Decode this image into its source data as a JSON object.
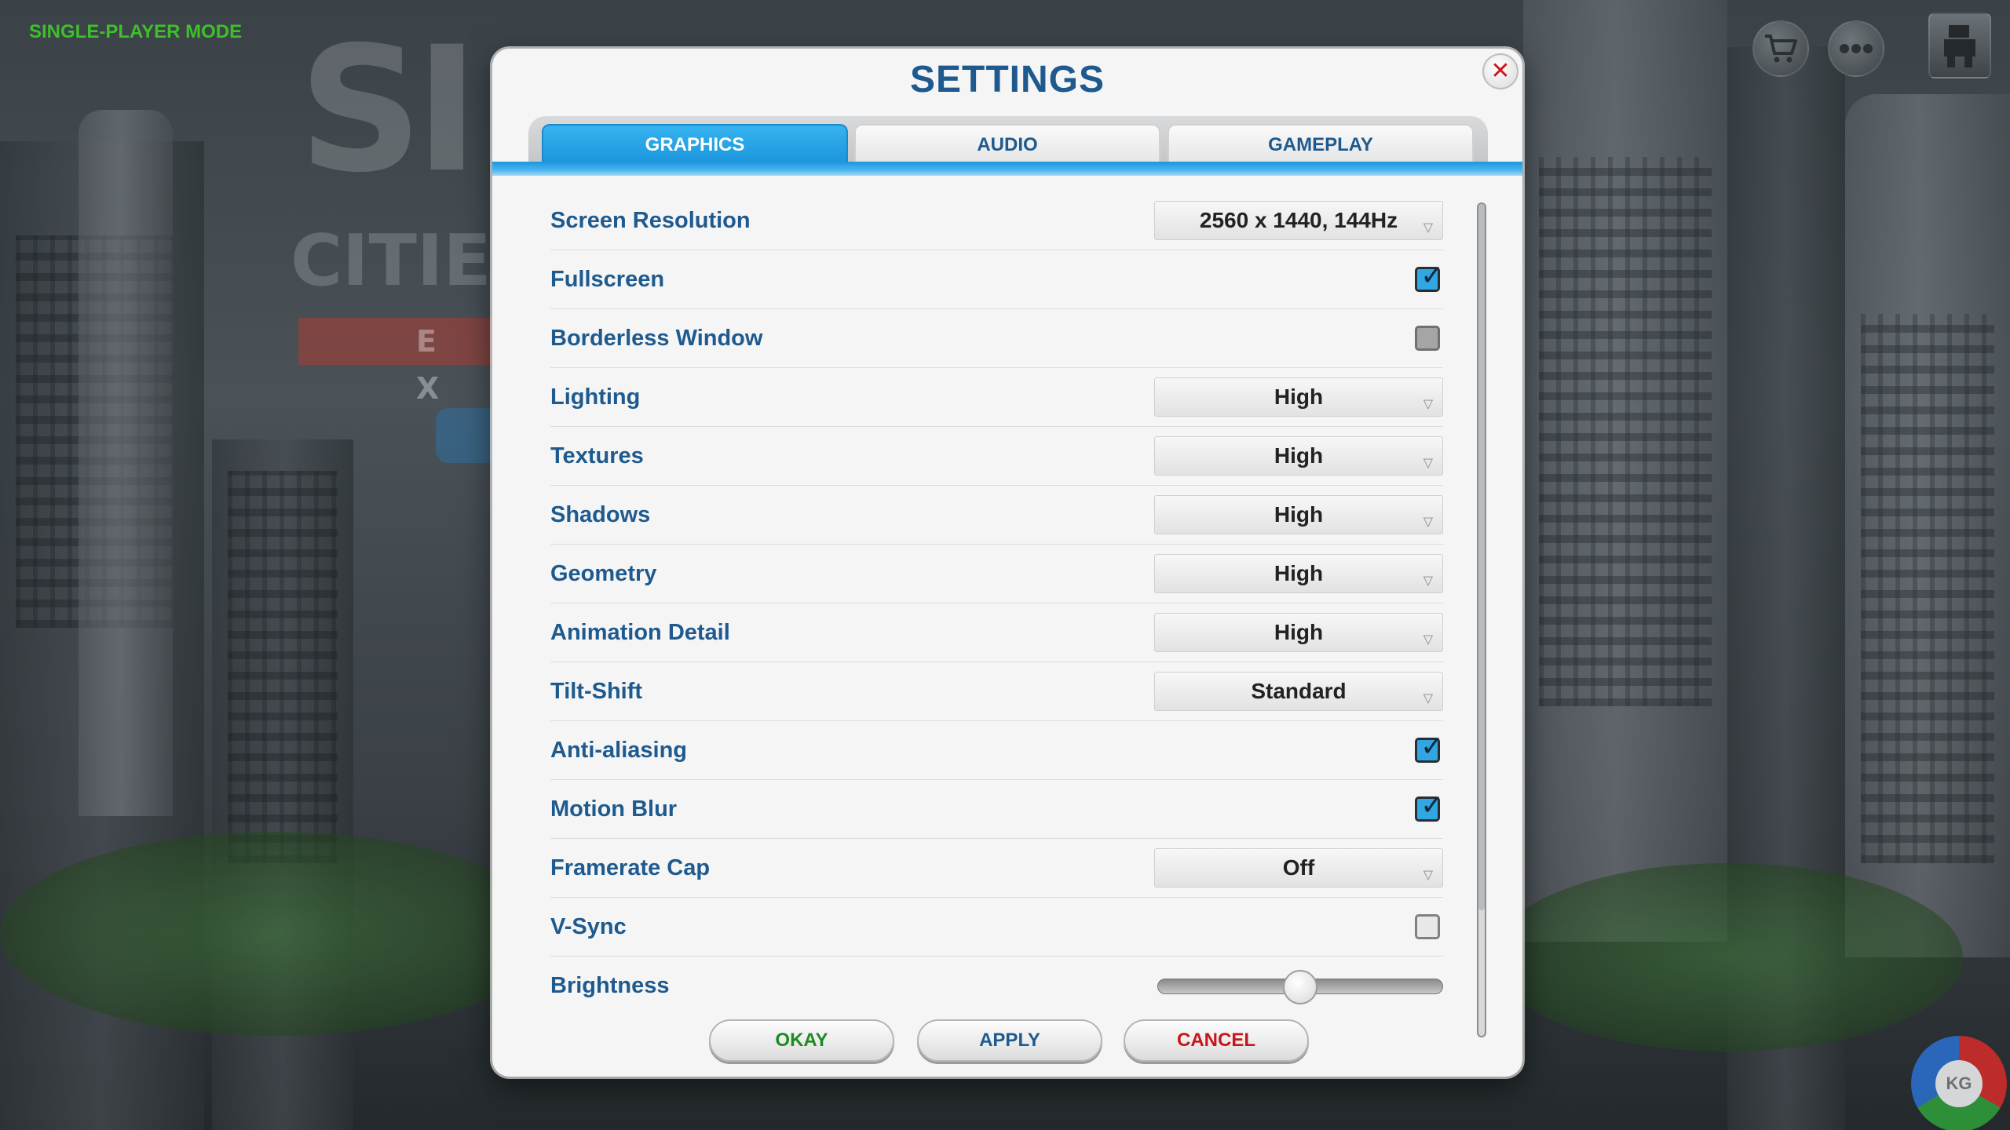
{
  "game_mode": "SINGLE-PLAYER MODE",
  "background_logo": {
    "line1": "SI",
    "line2": "CITIE",
    "strip": "E X"
  },
  "top_bar": {
    "cart_icon": "shopping-cart-icon",
    "more_icon": "ellipsis-icon",
    "avatar_icon": "player-avatar-icon"
  },
  "corner_watermark": "KG",
  "dialog": {
    "title": "SETTINGS",
    "close_glyph": "✕",
    "tabs": [
      {
        "label": "GRAPHICS",
        "active": true
      },
      {
        "label": "AUDIO",
        "active": false
      },
      {
        "label": "GAMEPLAY",
        "active": false
      }
    ],
    "settings": {
      "screen_resolution": {
        "label": "Screen Resolution",
        "value": "2560 x 1440, 144Hz"
      },
      "fullscreen": {
        "label": "Fullscreen",
        "checked": true
      },
      "borderless_window": {
        "label": "Borderless Window",
        "checked": false
      },
      "lighting": {
        "label": "Lighting",
        "value": "High"
      },
      "textures": {
        "label": "Textures",
        "value": "High"
      },
      "shadows": {
        "label": "Shadows",
        "value": "High"
      },
      "geometry": {
        "label": "Geometry",
        "value": "High"
      },
      "animation_detail": {
        "label": "Animation Detail",
        "value": "High"
      },
      "tilt_shift": {
        "label": "Tilt-Shift",
        "value": "Standard"
      },
      "anti_aliasing": {
        "label": "Anti-aliasing",
        "checked": true
      },
      "motion_blur": {
        "label": "Motion Blur",
        "checked": true
      },
      "framerate_cap": {
        "label": "Framerate Cap",
        "value": "Off"
      },
      "v_sync": {
        "label": "V-Sync",
        "checked": false
      },
      "brightness": {
        "label": "Brightness",
        "level": 0.5
      }
    },
    "buttons": {
      "okay": "OKAY",
      "apply": "APPLY",
      "cancel": "CANCEL"
    }
  },
  "colors": {
    "accent_blue": "#1e5a8e",
    "tab_active": "#1a94dc",
    "checkbox_checked": "#30a7e2",
    "okay_green": "#1e8a22",
    "cancel_red": "#c4161b",
    "mode_green": "#3fbf2c"
  }
}
